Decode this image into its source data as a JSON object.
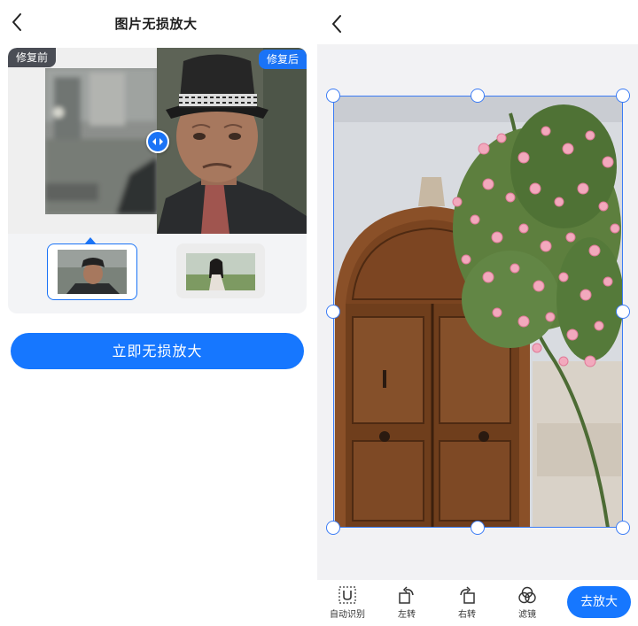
{
  "left_screen": {
    "title": "图片无损放大",
    "badge_before": "修复前",
    "badge_after": "修复后",
    "cta_label": "立即无损放大"
  },
  "right_screen": {
    "toolbar": {
      "auto_detect": "自动识别",
      "rotate_left": "左转",
      "rotate_right": "右转",
      "filter": "滤镜"
    },
    "go_button": "去放大"
  },
  "colors": {
    "accent": "#1677ff",
    "badge_dark": "#4a4d55",
    "crop_line": "#3b7cf5"
  },
  "icons": [
    "back-chevron-icon",
    "split-arrows-icon",
    "auto-detect-icon",
    "rotate-left-icon",
    "rotate-right-icon",
    "filter-icon"
  ]
}
